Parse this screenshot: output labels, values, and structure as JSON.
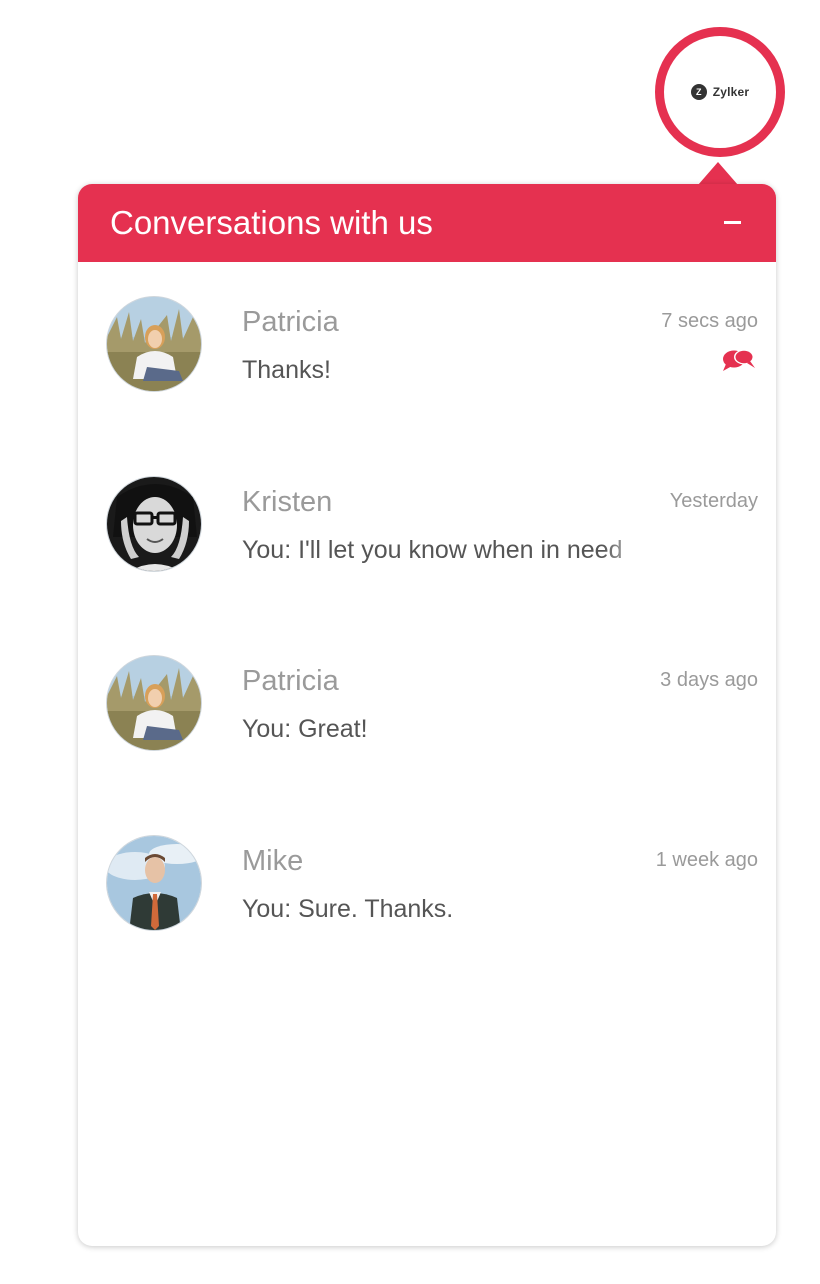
{
  "brand": {
    "mark": "Z",
    "name": "Zylker",
    "accent_color": "#e53150"
  },
  "panel": {
    "title": "Conversations with us",
    "minimize_label": "−"
  },
  "conversations": [
    {
      "name": "Patricia",
      "time": "7 secs ago",
      "message": "Thanks!",
      "avatar": "patricia-avatar",
      "unread": true
    },
    {
      "name": "Kristen",
      "time": "Yesterday",
      "message": "You: I'll let you know when in need",
      "avatar": "kristen-avatar",
      "unread": false
    },
    {
      "name": "Patricia",
      "time": "3 days ago",
      "message": "You: Great!",
      "avatar": "patricia-avatar",
      "unread": false
    },
    {
      "name": "Mike",
      "time": "1 week ago",
      "message": "You: Sure. Thanks.",
      "avatar": "mike-avatar",
      "unread": false
    }
  ],
  "icons": {
    "minimize": "minimize-icon",
    "unread": "chat-bubbles-icon"
  }
}
